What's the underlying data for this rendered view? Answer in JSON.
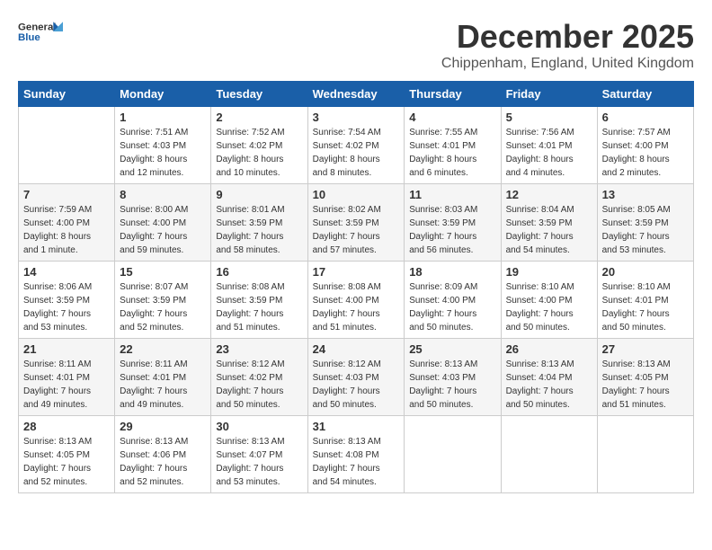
{
  "header": {
    "logo": {
      "general": "General",
      "blue": "Blue"
    },
    "title": "December 2025",
    "location": "Chippenham, England, United Kingdom"
  },
  "calendar": {
    "days_of_week": [
      "Sunday",
      "Monday",
      "Tuesday",
      "Wednesday",
      "Thursday",
      "Friday",
      "Saturday"
    ],
    "weeks": [
      [
        {
          "day": "",
          "info": ""
        },
        {
          "day": "1",
          "info": "Sunrise: 7:51 AM\nSunset: 4:03 PM\nDaylight: 8 hours\nand 12 minutes."
        },
        {
          "day": "2",
          "info": "Sunrise: 7:52 AM\nSunset: 4:02 PM\nDaylight: 8 hours\nand 10 minutes."
        },
        {
          "day": "3",
          "info": "Sunrise: 7:54 AM\nSunset: 4:02 PM\nDaylight: 8 hours\nand 8 minutes."
        },
        {
          "day": "4",
          "info": "Sunrise: 7:55 AM\nSunset: 4:01 PM\nDaylight: 8 hours\nand 6 minutes."
        },
        {
          "day": "5",
          "info": "Sunrise: 7:56 AM\nSunset: 4:01 PM\nDaylight: 8 hours\nand 4 minutes."
        },
        {
          "day": "6",
          "info": "Sunrise: 7:57 AM\nSunset: 4:00 PM\nDaylight: 8 hours\nand 2 minutes."
        }
      ],
      [
        {
          "day": "7",
          "info": "Sunrise: 7:59 AM\nSunset: 4:00 PM\nDaylight: 8 hours\nand 1 minute."
        },
        {
          "day": "8",
          "info": "Sunrise: 8:00 AM\nSunset: 4:00 PM\nDaylight: 7 hours\nand 59 minutes."
        },
        {
          "day": "9",
          "info": "Sunrise: 8:01 AM\nSunset: 3:59 PM\nDaylight: 7 hours\nand 58 minutes."
        },
        {
          "day": "10",
          "info": "Sunrise: 8:02 AM\nSunset: 3:59 PM\nDaylight: 7 hours\nand 57 minutes."
        },
        {
          "day": "11",
          "info": "Sunrise: 8:03 AM\nSunset: 3:59 PM\nDaylight: 7 hours\nand 56 minutes."
        },
        {
          "day": "12",
          "info": "Sunrise: 8:04 AM\nSunset: 3:59 PM\nDaylight: 7 hours\nand 54 minutes."
        },
        {
          "day": "13",
          "info": "Sunrise: 8:05 AM\nSunset: 3:59 PM\nDaylight: 7 hours\nand 53 minutes."
        }
      ],
      [
        {
          "day": "14",
          "info": "Sunrise: 8:06 AM\nSunset: 3:59 PM\nDaylight: 7 hours\nand 53 minutes."
        },
        {
          "day": "15",
          "info": "Sunrise: 8:07 AM\nSunset: 3:59 PM\nDaylight: 7 hours\nand 52 minutes."
        },
        {
          "day": "16",
          "info": "Sunrise: 8:08 AM\nSunset: 3:59 PM\nDaylight: 7 hours\nand 51 minutes."
        },
        {
          "day": "17",
          "info": "Sunrise: 8:08 AM\nSunset: 4:00 PM\nDaylight: 7 hours\nand 51 minutes."
        },
        {
          "day": "18",
          "info": "Sunrise: 8:09 AM\nSunset: 4:00 PM\nDaylight: 7 hours\nand 50 minutes."
        },
        {
          "day": "19",
          "info": "Sunrise: 8:10 AM\nSunset: 4:00 PM\nDaylight: 7 hours\nand 50 minutes."
        },
        {
          "day": "20",
          "info": "Sunrise: 8:10 AM\nSunset: 4:01 PM\nDaylight: 7 hours\nand 50 minutes."
        }
      ],
      [
        {
          "day": "21",
          "info": "Sunrise: 8:11 AM\nSunset: 4:01 PM\nDaylight: 7 hours\nand 49 minutes."
        },
        {
          "day": "22",
          "info": "Sunrise: 8:11 AM\nSunset: 4:01 PM\nDaylight: 7 hours\nand 49 minutes."
        },
        {
          "day": "23",
          "info": "Sunrise: 8:12 AM\nSunset: 4:02 PM\nDaylight: 7 hours\nand 50 minutes."
        },
        {
          "day": "24",
          "info": "Sunrise: 8:12 AM\nSunset: 4:03 PM\nDaylight: 7 hours\nand 50 minutes."
        },
        {
          "day": "25",
          "info": "Sunrise: 8:13 AM\nSunset: 4:03 PM\nDaylight: 7 hours\nand 50 minutes."
        },
        {
          "day": "26",
          "info": "Sunrise: 8:13 AM\nSunset: 4:04 PM\nDaylight: 7 hours\nand 50 minutes."
        },
        {
          "day": "27",
          "info": "Sunrise: 8:13 AM\nSunset: 4:05 PM\nDaylight: 7 hours\nand 51 minutes."
        }
      ],
      [
        {
          "day": "28",
          "info": "Sunrise: 8:13 AM\nSunset: 4:05 PM\nDaylight: 7 hours\nand 52 minutes."
        },
        {
          "day": "29",
          "info": "Sunrise: 8:13 AM\nSunset: 4:06 PM\nDaylight: 7 hours\nand 52 minutes."
        },
        {
          "day": "30",
          "info": "Sunrise: 8:13 AM\nSunset: 4:07 PM\nDaylight: 7 hours\nand 53 minutes."
        },
        {
          "day": "31",
          "info": "Sunrise: 8:13 AM\nSunset: 4:08 PM\nDaylight: 7 hours\nand 54 minutes."
        },
        {
          "day": "",
          "info": ""
        },
        {
          "day": "",
          "info": ""
        },
        {
          "day": "",
          "info": ""
        }
      ]
    ]
  }
}
